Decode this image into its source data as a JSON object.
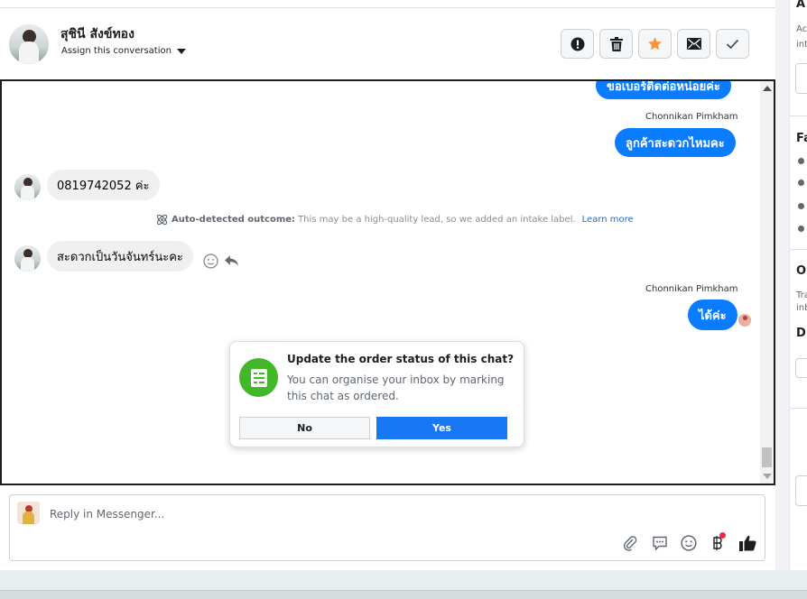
{
  "header": {
    "contact_name": "สุชินี สังข์ทอง",
    "assign_label": "Assign this conversation",
    "actions": [
      {
        "name": "report-button",
        "icon": "exclamation-circle-icon"
      },
      {
        "name": "delete-button",
        "icon": "trash-icon"
      },
      {
        "name": "follow-up-button",
        "icon": "star-icon",
        "color": "#f7923b"
      },
      {
        "name": "mark-unread-button",
        "icon": "envelope-icon"
      },
      {
        "name": "mark-done-button",
        "icon": "checkmark-icon"
      }
    ]
  },
  "messages": {
    "m0_text": "ขอเบอร์ติดต่อหน่อยค่ะ",
    "m1_sender": "Chonnikan Pimkham",
    "m1_text": "ลูกค้าสะดวกไหมคะ",
    "m2_text": "0819742052 ค่ะ",
    "outcome_label": "Auto-detected outcome:",
    "outcome_text": "This may be a high-quality lead, so we added an intake label.",
    "outcome_link": "Learn more",
    "m3_text": "สะดวกเป็นวันจันทร์นะคะ",
    "m4_sender": "Chonnikan Pimkham",
    "m4_text": "ได้ค่ะ"
  },
  "popup": {
    "title": "Update the order status of this chat?",
    "description": "You can organise your inbox by marking this chat as ordered.",
    "no_label": "No",
    "yes_label": "Yes"
  },
  "composer": {
    "placeholder": "Reply in Messenger...",
    "tools": [
      "paperclip-icon",
      "saved-reply-icon",
      "emoji-icon",
      "baht-payment-icon",
      "thumbs-up-icon"
    ]
  },
  "right_panel": {
    "a_text": "A",
    "ad_text": "Ac",
    "in_text": "int",
    "f_text": "Fa",
    "o_text": "O",
    "tr_text": "Tra",
    "inb_text": "inb",
    "d_text": "D"
  },
  "colors": {
    "accent": "#1877f2",
    "bubble_out": "#0a7cff",
    "bubble_in": "#f0f0f0",
    "success": "#42b72a",
    "star": "#f7923b"
  }
}
